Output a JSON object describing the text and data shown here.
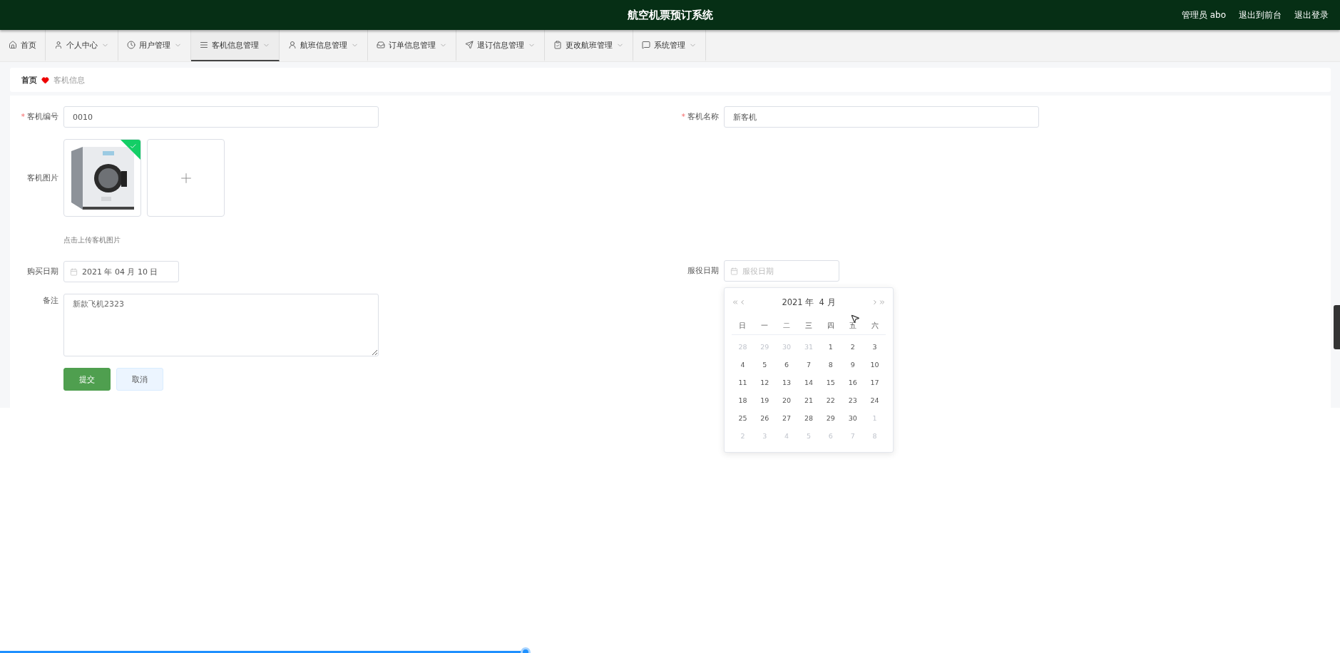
{
  "header": {
    "title": "航空机票预订系统",
    "links": [
      "管理员 abo",
      "退出到前台",
      "退出登录"
    ]
  },
  "nav": [
    {
      "label": "首页",
      "dropdown": false,
      "selected": false
    },
    {
      "label": "个人中心",
      "dropdown": true,
      "selected": false
    },
    {
      "label": "用户管理",
      "dropdown": true,
      "selected": false
    },
    {
      "label": "客机信息管理",
      "dropdown": true,
      "selected": true
    },
    {
      "label": "航班信息管理",
      "dropdown": true,
      "selected": false
    },
    {
      "label": "订单信息管理",
      "dropdown": true,
      "selected": false
    },
    {
      "label": "退订信息管理",
      "dropdown": true,
      "selected": false
    },
    {
      "label": "更改航班管理",
      "dropdown": true,
      "selected": false
    },
    {
      "label": "系统管理",
      "dropdown": true,
      "selected": false
    }
  ],
  "breadcrumb": {
    "home": "首页",
    "current": "客机信息"
  },
  "form": {
    "plane_no": {
      "required_mark": "*",
      "label": "客机编号",
      "value": "0010"
    },
    "plane_name": {
      "required_mark": "*",
      "label": "客机名称",
      "value": "新客机"
    },
    "image": {
      "label": "客机图片",
      "uploaded": true,
      "hint": "点击上传客机图片"
    },
    "purchase_date": {
      "label": "购买日期",
      "value": "2021 年 04 月 10 日"
    },
    "service_date": {
      "label": "服役日期",
      "placeholder": "服役日期"
    },
    "remark": {
      "label": "备注",
      "value": "新款飞机2323"
    },
    "buttons": [
      {
        "label": "提交",
        "kind": "primary"
      },
      {
        "label": "取消",
        "kind": "plain"
      }
    ]
  },
  "calendar": {
    "title": "2021 年  4 月",
    "weekdays": [
      "日",
      "一",
      "二",
      "三",
      "四",
      "五",
      "六"
    ],
    "days": [
      {
        "label": "28",
        "outside": true
      },
      {
        "label": "29",
        "outside": true
      },
      {
        "label": "30",
        "outside": true
      },
      {
        "label": "31",
        "outside": true
      },
      {
        "label": "1",
        "outside": false
      },
      {
        "label": "2",
        "outside": false
      },
      {
        "label": "3",
        "outside": false
      },
      {
        "label": "4",
        "outside": false
      },
      {
        "label": "5",
        "outside": false
      },
      {
        "label": "6",
        "outside": false
      },
      {
        "label": "7",
        "outside": false
      },
      {
        "label": "8",
        "outside": false
      },
      {
        "label": "9",
        "outside": false
      },
      {
        "label": "10",
        "outside": false
      },
      {
        "label": "11",
        "outside": false
      },
      {
        "label": "12",
        "outside": false
      },
      {
        "label": "13",
        "outside": false
      },
      {
        "label": "14",
        "outside": false
      },
      {
        "label": "15",
        "outside": false
      },
      {
        "label": "16",
        "outside": false
      },
      {
        "label": "17",
        "outside": false
      },
      {
        "label": "18",
        "outside": false
      },
      {
        "label": "19",
        "outside": false
      },
      {
        "label": "20",
        "outside": false
      },
      {
        "label": "21",
        "outside": false
      },
      {
        "label": "22",
        "outside": false
      },
      {
        "label": "23",
        "outside": false
      },
      {
        "label": "24",
        "outside": false
      },
      {
        "label": "25",
        "outside": false
      },
      {
        "label": "26",
        "outside": false
      },
      {
        "label": "27",
        "outside": false
      },
      {
        "label": "28",
        "outside": false
      },
      {
        "label": "29",
        "outside": false
      },
      {
        "label": "30",
        "outside": false
      },
      {
        "label": "1",
        "outside": true
      },
      {
        "label": "2",
        "outside": true
      },
      {
        "label": "3",
        "outside": true
      },
      {
        "label": "4",
        "outside": true
      },
      {
        "label": "5",
        "outside": true
      },
      {
        "label": "6",
        "outside": true
      },
      {
        "label": "7",
        "outside": true
      },
      {
        "label": "8",
        "outside": true
      }
    ]
  },
  "progress": {
    "level": 0.392
  }
}
